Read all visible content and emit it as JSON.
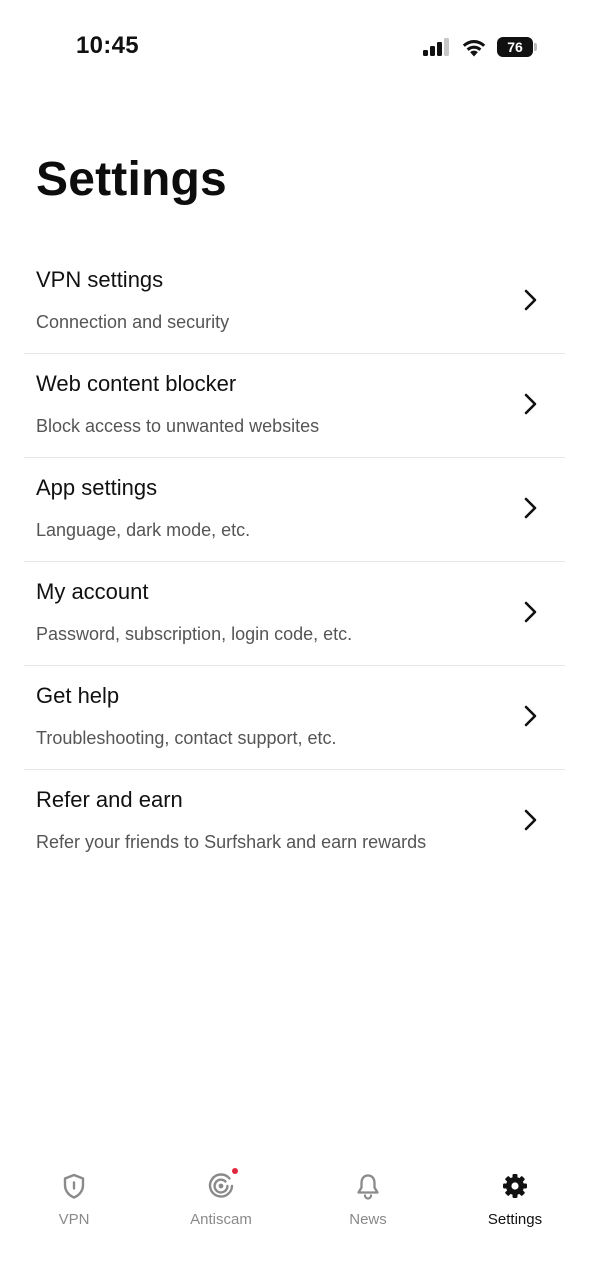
{
  "status_bar": {
    "time": "10:45",
    "battery_level": "76",
    "icons": [
      "signal-icon",
      "wifi-icon",
      "battery-icon"
    ]
  },
  "header": {
    "title": "Settings"
  },
  "settings": [
    {
      "title": "VPN settings",
      "subtitle": "Connection and security"
    },
    {
      "title": "Web content blocker",
      "subtitle": "Block access to unwanted websites"
    },
    {
      "title": "App settings",
      "subtitle": "Language, dark mode, etc."
    },
    {
      "title": "My account",
      "subtitle": "Password, subscription, login code, etc."
    },
    {
      "title": "Get help",
      "subtitle": "Troubleshooting, contact support, etc."
    },
    {
      "title": "Refer and earn",
      "subtitle": "Refer your friends to Surfshark and earn rewards"
    }
  ],
  "tabs": [
    {
      "label": "VPN",
      "icon": "shield-icon",
      "active": false
    },
    {
      "label": "Antiscam",
      "icon": "radar-icon",
      "active": false,
      "has_notification": true
    },
    {
      "label": "News",
      "icon": "bell-icon",
      "active": false
    },
    {
      "label": "Settings",
      "icon": "gear-icon",
      "active": true
    }
  ],
  "colors": {
    "background": "#ffffff",
    "text_primary": "#111111",
    "text_secondary": "#555555",
    "tab_inactive": "#8a8a8a",
    "divider": "#e6e6e6",
    "notification_dot": "#e0263d"
  }
}
